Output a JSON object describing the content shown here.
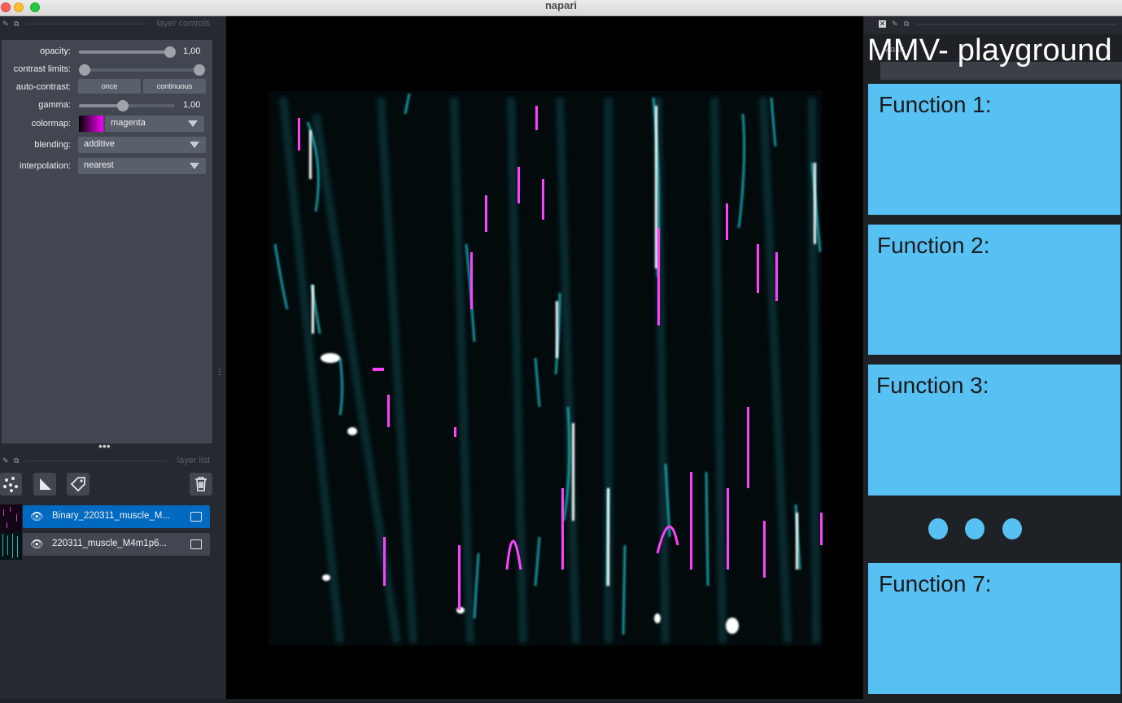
{
  "window": {
    "title": "napari"
  },
  "layer_controls": {
    "header": "layer controls",
    "opacity": {
      "label": "opacity:",
      "value": "1,00",
      "level": 1.0
    },
    "contrast_limits": {
      "label": "contrast limits:"
    },
    "auto_contrast": {
      "label": "auto-contrast:",
      "once": "once",
      "continuous": "continuous"
    },
    "gamma": {
      "label": "gamma:",
      "value": "1,00"
    },
    "colormap": {
      "label": "colormap:",
      "value": "magenta"
    },
    "blending": {
      "label": "blending:",
      "value": "additive"
    },
    "interpolation": {
      "label": "interpolation:",
      "value": "nearest"
    }
  },
  "layer_list": {
    "header": "layer list",
    "layers": [
      {
        "name": "Binary_220311_muscle_M...",
        "selected": true
      },
      {
        "name": "220311_muscle_M4m1p6...",
        "selected": false
      }
    ]
  },
  "plugin": {
    "ghost_label": "Mask",
    "title": "MMV- playground",
    "functions": [
      "Function 1:",
      "Function 2:",
      "Function 3:",
      "Function 7:"
    ]
  },
  "colors": {
    "accent": "#58c1f3",
    "selected_layer": "#0069c0",
    "panel": "#262930",
    "control_bg": "#414651"
  }
}
